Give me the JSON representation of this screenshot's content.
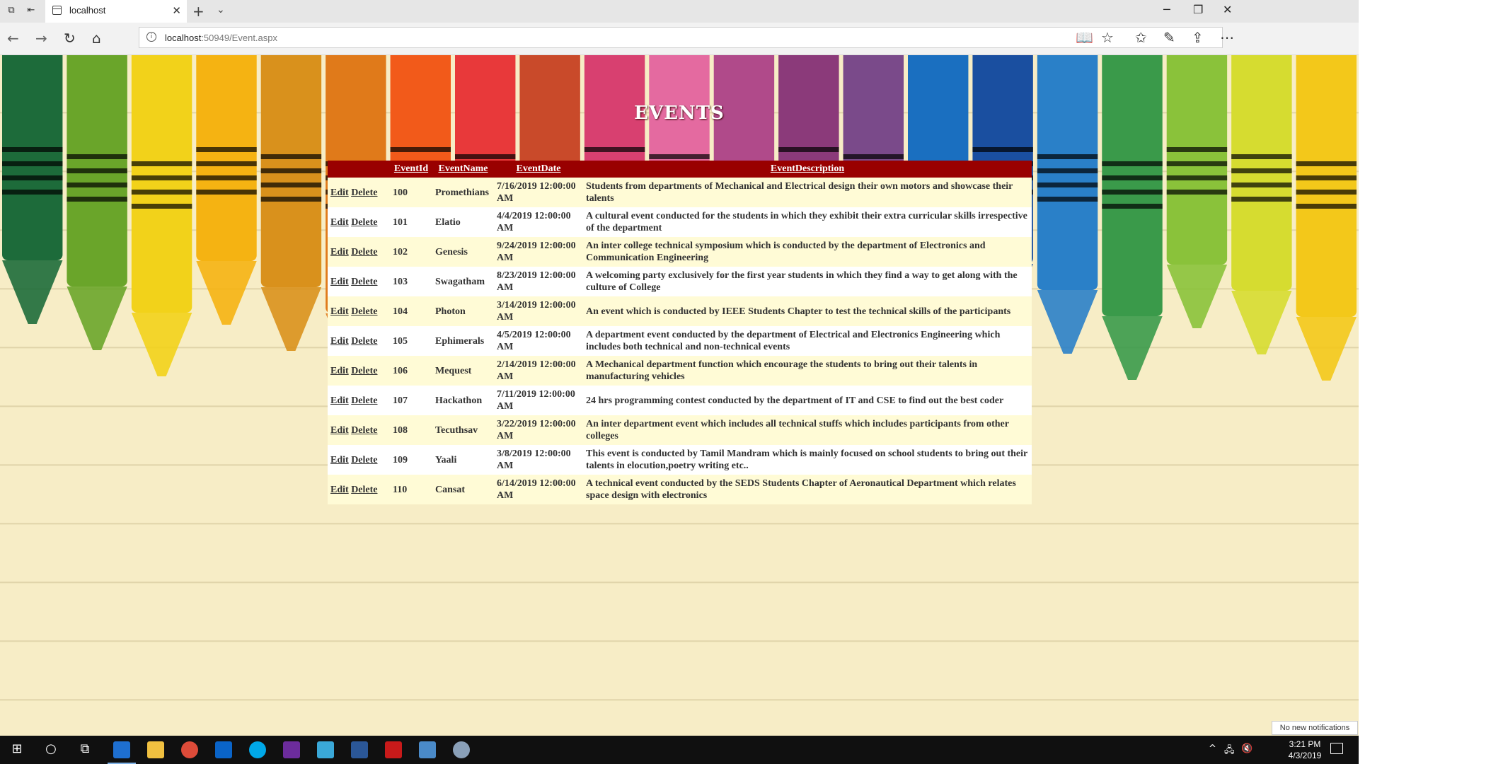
{
  "browser": {
    "tab_title": "localhost",
    "new_tab_symbol": "+",
    "url_host": "localhost",
    "url_path": ":50949/Event.aspx"
  },
  "page": {
    "heading": "EVENTS",
    "columns": [
      "",
      "EventId",
      "EventName",
      "EventDate",
      "EventDescription"
    ],
    "edit_label": "Edit",
    "delete_label": "Delete",
    "header_color": "#990000",
    "rows": [
      {
        "id": "100",
        "name": "Promethians",
        "date": "7/16/2019 12:00:00 AM",
        "description": "Students from departments of Mechanical and Electrical design their own motors and showcase their talents"
      },
      {
        "id": "101",
        "name": "Elatio",
        "date": "4/4/2019 12:00:00 AM",
        "description": "A cultural event conducted for the students in which they exhibit their extra curricular skills irrespective of the department"
      },
      {
        "id": "102",
        "name": "Genesis",
        "date": "9/24/2019 12:00:00 AM",
        "description": "An inter college technical symposium which is conducted by the department of Electronics and Communication Engineering"
      },
      {
        "id": "103",
        "name": "Swagatham",
        "date": "8/23/2019 12:00:00 AM",
        "description": "A welcoming party exclusively for the first year students in which they find a way to get along with the culture of College"
      },
      {
        "id": "104",
        "name": "Photon",
        "date": "3/14/2019 12:00:00 AM",
        "description": "An event which is conducted by IEEE Students Chapter to test the technical skills of the participants"
      },
      {
        "id": "105",
        "name": "Ephimerals",
        "date": "4/5/2019 12:00:00 AM",
        "description": "A department event conducted by the department of Electrical and Electronics Engineering which includes both technical and non-technical events"
      },
      {
        "id": "106",
        "name": "Mequest",
        "date": "2/14/2019 12:00:00 AM",
        "description": "A Mechanical department function which encourage the students to bring out their talents in manufacturing vehicles"
      },
      {
        "id": "107",
        "name": "Hackathon",
        "date": "7/11/2019 12:00:00 AM",
        "description": "24 hrs programming contest conducted by the department of IT and CSE to find out the best coder"
      },
      {
        "id": "108",
        "name": "Tecuthsav",
        "date": "3/22/2019 12:00:00 AM",
        "description": "An inter department event which includes all technical stuffs which includes participants from other colleges"
      },
      {
        "id": "109",
        "name": "Yaali",
        "date": "3/8/2019 12:00:00 AM",
        "description": "This event is conducted by Tamil Mandram which is mainly focused on school students to bring out their talents in elocution,poetry writing etc.."
      },
      {
        "id": "110",
        "name": "Cansat",
        "date": "6/14/2019 12:00:00 AM",
        "description": "A technical event conducted by the SEDS Students Chapter of Aeronautical Department which relates space design with electronics"
      }
    ]
  },
  "toast": "No new notifications",
  "taskbar": {
    "time": "3:21 PM",
    "date": "4/3/2019"
  },
  "crayon_colors": [
    "#1d6b3a",
    "#6aa52a",
    "#f2d21a",
    "#f5b312",
    "#d9911c",
    "#e07a1a",
    "#f25a1a",
    "#e8393a",
    "#c94a2a",
    "#d84070",
    "#e46aa0",
    "#b04a8a",
    "#8b3a7a",
    "#7a4a8a",
    "#1a6fc0",
    "#1a4fa0",
    "#2a80c8",
    "#3a9a4a",
    "#8ac23a",
    "#d6dc30",
    "#f3c81a"
  ]
}
